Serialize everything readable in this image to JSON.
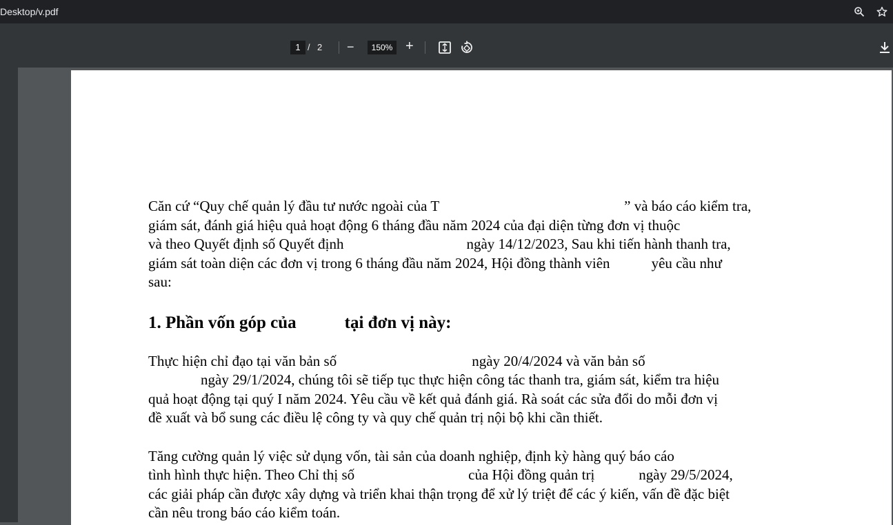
{
  "window": {
    "title": "Desktop/v.pdf",
    "icons": [
      "zoom-icon",
      "star-icon"
    ]
  },
  "toolbar": {
    "current_page": "1",
    "page_separator": "/",
    "total_pages": "2",
    "zoom_out": "−",
    "zoom_level": "150%",
    "zoom_in": "+",
    "icons": [
      "fit-page-icon",
      "rotate-icon",
      "download-icon"
    ]
  },
  "document": {
    "para1_line1": "Căn cứ “Quy chế quản lý đầu tư nước ngoài của T",
    "para1_line1_end": "” và báo cáo kiểm tra,",
    "para1_line2": "giám sát, đánh giá hiệu quả hoạt động 6 tháng đầu năm 2024 của đại diện từng đơn vị thuộc",
    "para1_line3": "và theo Quyết định số Quyết định",
    "para1_line3_end": "ngày 14/12/2023, Sau khi tiến hành thanh tra,",
    "para1_line4": "giám sát toàn diện các đơn vị trong 6 tháng đầu năm 2024, Hội đồng thành viên",
    "para1_line4_end": "yêu cầu như",
    "para1_line5": "sau:",
    "heading1": "1. Phần vốn góp của",
    "heading1_end": "tại đơn vị này:",
    "para2_line1": "Thực hiện chỉ đạo tại văn bản số",
    "para2_line1_mid": "ngày 20/4/2024 và văn bản số",
    "para2_line2": "ngày 29/1/2024, chúng tôi sẽ tiếp tục thực hiện công tác thanh tra, giám sát, kiểm tra hiệu",
    "para2_line3": "quả hoạt động tại quý I năm 2024. Yêu cầu về kết quả đánh giá. Rà soát các sửa đổi do mỗi đơn vị",
    "para2_line4": "đề xuất và bổ sung các điều lệ công ty và quy chế quản trị nội bộ khi cần thiết.",
    "para3_line1": "Tăng cường quản lý việc sử dụng vốn, tài sản của doanh nghiệp, định kỳ hàng quý báo cáo",
    "para3_line2": "tình hình thực hiện. Theo Chỉ thị số",
    "para3_line2_mid": "của Hội đồng quản trị",
    "para3_line2_end": "ngày 29/5/2024,",
    "para3_line3": "các giải pháp cần được xây dựng và triển khai thận trọng để xử lý triệt để các ý kiến, vấn đề đặc biệt",
    "para3_line4": "cần nêu trong báo cáo kiểm toán."
  }
}
